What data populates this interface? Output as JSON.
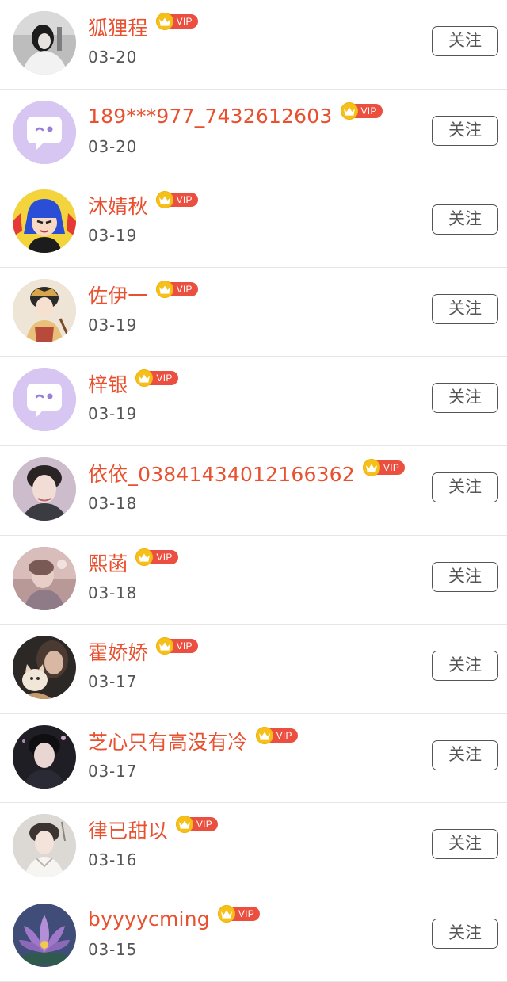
{
  "follow_label": "关注",
  "vip_label": "VIP",
  "colors": {
    "name": "#e8502f",
    "vip_tag": "#ea4f3f",
    "crown": "#f6c01b",
    "date": "#555555",
    "divider": "#e6e6e6"
  },
  "users": [
    {
      "name": "狐狸程",
      "date": "03-20",
      "avatar": "photo-girl-dark-hair",
      "bg": "#9a9a9a"
    },
    {
      "name": "189***977_7432612603",
      "date": "03-20",
      "avatar": "default-chat-bubble",
      "bg": "#d8c5f3"
    },
    {
      "name": "沐婧秋",
      "date": "03-19",
      "avatar": "cartoon-blue-hair",
      "bg": "#f6d23a"
    },
    {
      "name": "佐伊一",
      "date": "03-19",
      "avatar": "painted-girl",
      "bg": "#efe7da"
    },
    {
      "name": "梓银",
      "date": "03-19",
      "avatar": "default-chat-bubble",
      "bg": "#d8c5f3"
    },
    {
      "name": "依依_03841434012166362",
      "date": "03-18",
      "avatar": "photo-young-man",
      "bg": "#c9b8c4"
    },
    {
      "name": "熙菡",
      "date": "03-18",
      "avatar": "photo-blurry-girl",
      "bg": "#c5a6a6"
    },
    {
      "name": "霍娇娇",
      "date": "03-17",
      "avatar": "photo-man-with-cat",
      "bg": "#2e2a28"
    },
    {
      "name": "芝心只有高没有冷",
      "date": "03-17",
      "avatar": "photo-dark-portrait",
      "bg": "#1f1f26"
    },
    {
      "name": "律已甜以",
      "date": "03-16",
      "avatar": "photo-guy-soft",
      "bg": "#d7d3cf"
    },
    {
      "name": "byyyycming",
      "date": "03-15",
      "avatar": "lotus-flower",
      "bg": "#4d5c83"
    }
  ]
}
